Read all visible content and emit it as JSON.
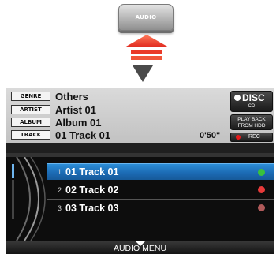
{
  "hardware_button": {
    "label": "AUDIO"
  },
  "info": {
    "genre_tag": "GENRE",
    "genre": "Others",
    "artist_tag": "ARTIST",
    "artist": "Artist 01",
    "album_tag": "ALBUM",
    "album": "Album 01",
    "track_tag": "TRACK",
    "track": "01 Track 01",
    "elapsed": "0'50\""
  },
  "side_buttons": {
    "disc": "DISC",
    "disc_sub": "CD",
    "playback_line1": "PLAY BACK",
    "playback_line2": "FROM HDD",
    "rec": "REC"
  },
  "tracks": [
    {
      "num": "1",
      "name": "01 Track 01",
      "selected": true,
      "status_color": "#39c23c"
    },
    {
      "num": "2",
      "name": "02 Track 02",
      "selected": false,
      "status_color": "#e83a3a"
    },
    {
      "num": "3",
      "name": "03 Track 03",
      "selected": false,
      "status_color": "#b05a5a"
    }
  ],
  "menu": {
    "label": "AUDIO MENU"
  },
  "colors": {
    "press_arrow": "#e8392a",
    "selection": "#1f78c4",
    "rec_dot": "#e81b1b"
  }
}
